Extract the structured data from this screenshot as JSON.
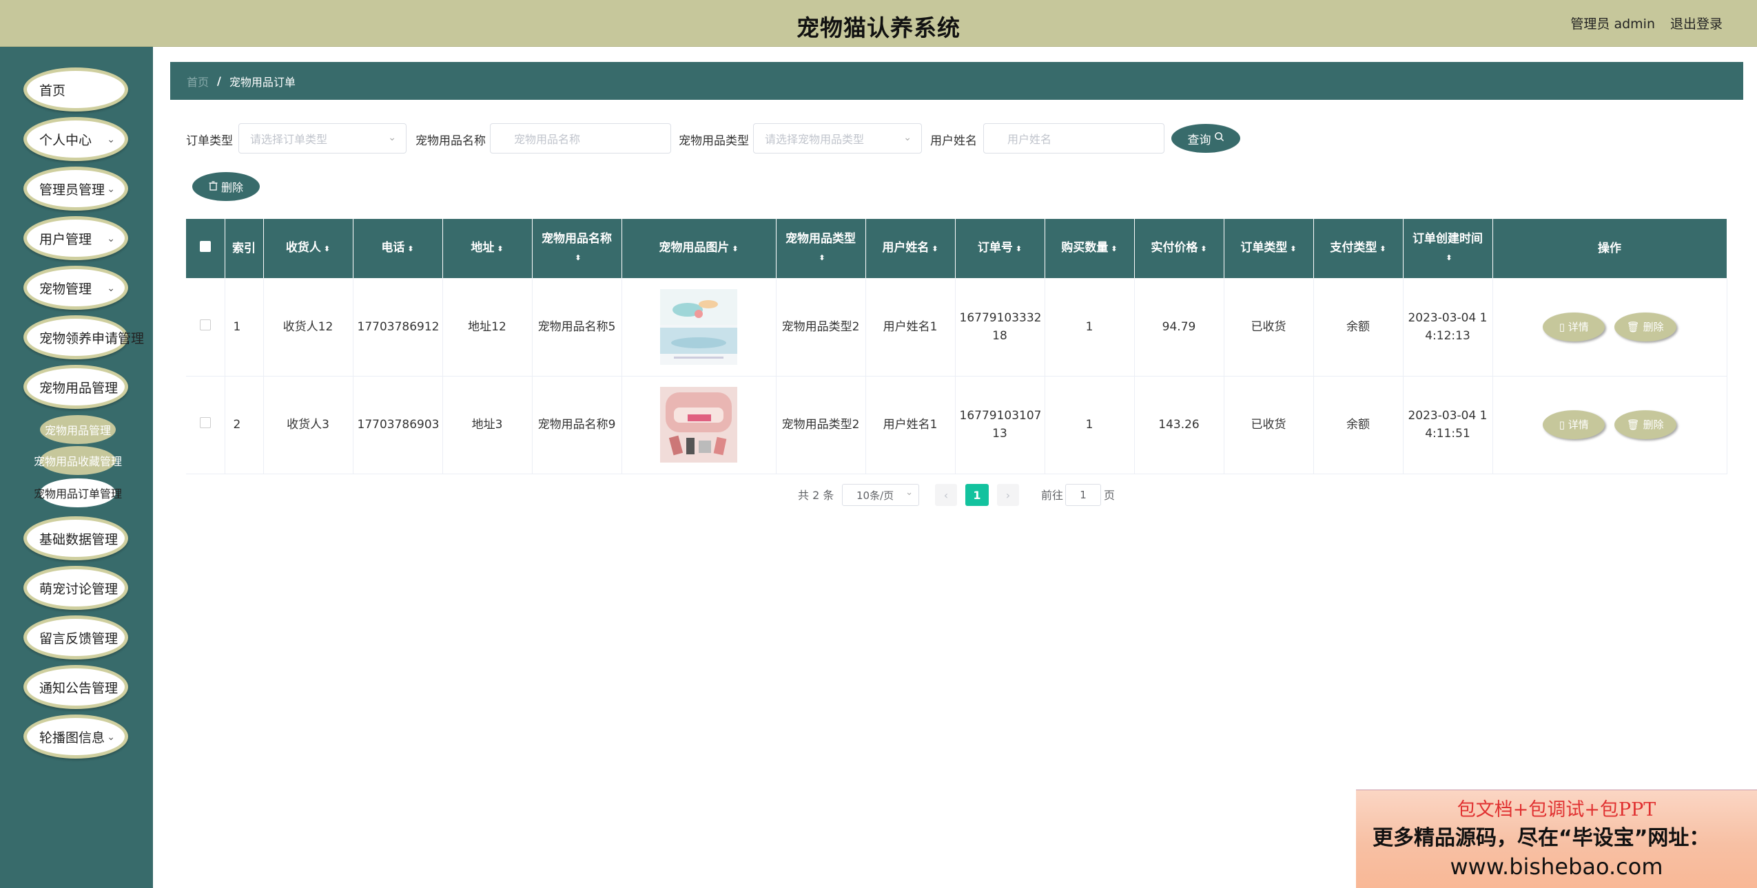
{
  "header": {
    "title": "宠物猫认养系统",
    "user": "管理员 admin",
    "logout": "退出登录"
  },
  "sidebar": {
    "items": [
      {
        "label": "首页"
      },
      {
        "label": "个人中心"
      },
      {
        "label": "管理员管理"
      },
      {
        "label": "用户管理"
      },
      {
        "label": "宠物管理"
      },
      {
        "label": "宠物领养申请管理"
      },
      {
        "label": "宠物用品管理"
      },
      {
        "label": "基础数据管理"
      },
      {
        "label": "萌宠讨论管理"
      },
      {
        "label": "留言反馈管理"
      },
      {
        "label": "通知公告管理"
      },
      {
        "label": "轮播图信息"
      }
    ],
    "sub_items": [
      {
        "label": "宠物用品管理"
      },
      {
        "label": "宠物用品收藏管理"
      },
      {
        "label": "宠物用品订单管理"
      }
    ]
  },
  "breadcrumb": {
    "home": "首页",
    "separator": "/",
    "current": "宠物用品订单"
  },
  "search": {
    "order_type_label": "订单类型",
    "order_type_placeholder": "请选择订单类型",
    "product_name_label": "宠物用品名称",
    "product_name_placeholder": "宠物用品名称",
    "product_type_label": "宠物用品类型",
    "product_type_placeholder": "请选择宠物用品类型",
    "user_name_label": "用户姓名",
    "user_name_placeholder": "用户姓名",
    "query_button": "查询",
    "delete_button": "删除"
  },
  "table": {
    "headers": [
      "索引",
      "收货人",
      "电话",
      "地址",
      "宠物用品名称",
      "宠物用品图片",
      "宠物用品类型",
      "用户姓名",
      "订单号",
      "购买数量",
      "实付价格",
      "订单类型",
      "支付类型",
      "订单创建时间",
      "操作"
    ],
    "rows": [
      {
        "index": "1",
        "receiver": "收货人12",
        "phone": "17703786912",
        "address": "地址12",
        "product_name": "宠物用品名称5",
        "product_type": "宠物用品类型2",
        "user_name": "用户姓名1",
        "order_no_1": "16779103332",
        "order_no_2": "18",
        "quantity": "1",
        "price": "94.79",
        "order_type": "已收货",
        "pay_type": "余额",
        "time_1": "2023-03-04 1",
        "time_2": "4:12:13",
        "detail": "详情",
        "delete": "删除"
      },
      {
        "index": "2",
        "receiver": "收货人3",
        "phone": "17703786903",
        "address": "地址3",
        "product_name": "宠物用品名称9",
        "product_type": "宠物用品类型2",
        "user_name": "用户姓名1",
        "order_no_1": "16779103107",
        "order_no_2": "13",
        "quantity": "1",
        "price": "143.26",
        "order_type": "已收货",
        "pay_type": "余额",
        "time_1": "2023-03-04 1",
        "time_2": "4:11:51",
        "detail": "详情",
        "delete": "删除"
      }
    ]
  },
  "pagination": {
    "total": "共 2 条",
    "page_size": "10条/页",
    "prev": "‹",
    "current_page": "1",
    "next": "›",
    "goto_label": "前往",
    "goto_value": "1",
    "goto_suffix": "页"
  },
  "ad": {
    "line1": "包文档+包调试+包PPT",
    "line2": "更多精品源码，尽在“毕设宝”网址：",
    "line3": "www.bishebao.com"
  },
  "colors": {
    "accent": "#386b6b",
    "header_bg": "#c6c79b",
    "pager_active": "#13c29e"
  }
}
